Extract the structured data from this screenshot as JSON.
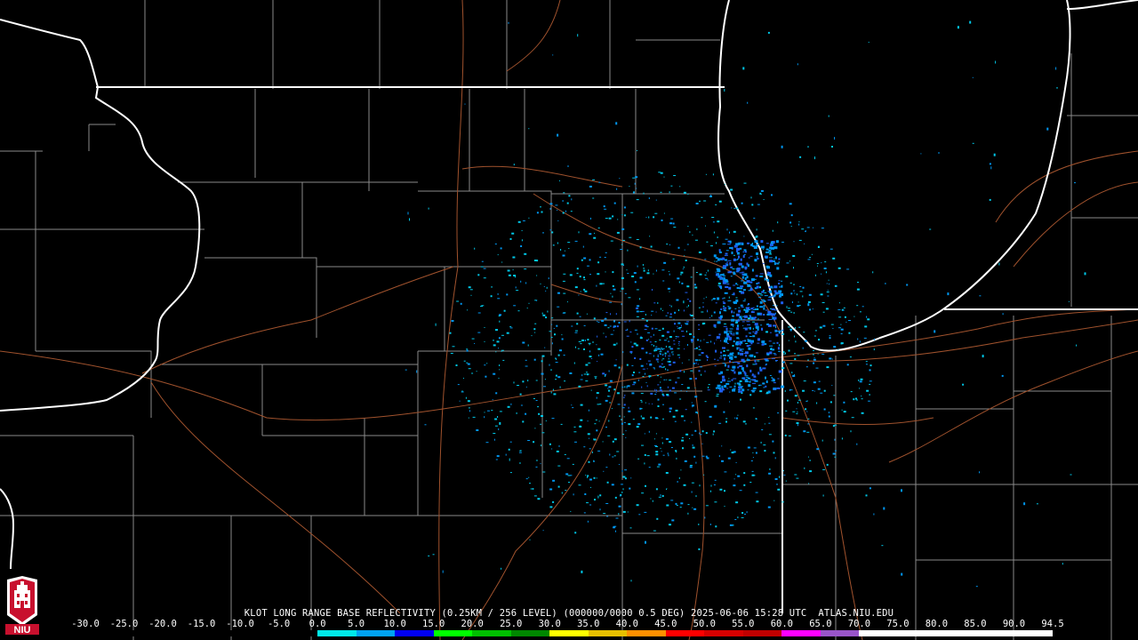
{
  "product": {
    "caption": "KLOT LONG RANGE BASE REFLECTIVITY (0.25KM / 256 LEVEL) (000000/0000 0.5 DEG) 2025-06-06 15:28 UTC  ATLAS.NIU.EDU"
  },
  "scale": {
    "labels": [
      "-30.0",
      "-25.0",
      "-20.0",
      "-15.0",
      "-10.0",
      "-5.0",
      "0.0",
      "5.0",
      "10.0",
      "15.0",
      "20.0",
      "25.0",
      "30.0",
      "35.0",
      "40.0",
      "45.0",
      "50.0",
      "55.0",
      "60.0",
      "65.0",
      "70.0",
      "75.0",
      "80.0",
      "85.0",
      "90.0",
      "94.5"
    ],
    "colors": [
      "#000000",
      "#000000",
      "#000000",
      "#000000",
      "#000000",
      "#000000",
      "#00e8e8",
      "#00a2f0",
      "#0000f0",
      "#00ff00",
      "#00c000",
      "#008800",
      "#ffff00",
      "#e7c000",
      "#ff9000",
      "#ff0000",
      "#d60000",
      "#c00000",
      "#ff00ff",
      "#9955c9",
      "#ffffff",
      "#ffffff",
      "#ffffff",
      "#ffffff",
      "#ffffff"
    ]
  },
  "colors": {
    "background": "#000000",
    "county_line": "#8a8a8a",
    "state_line": "#ffffff",
    "road": "#a0522d",
    "echo_light": "#00c8e8",
    "echo_mid": "#0096f0",
    "echo_strong": "#1e5ff0"
  },
  "logo": {
    "label": "NIU"
  }
}
